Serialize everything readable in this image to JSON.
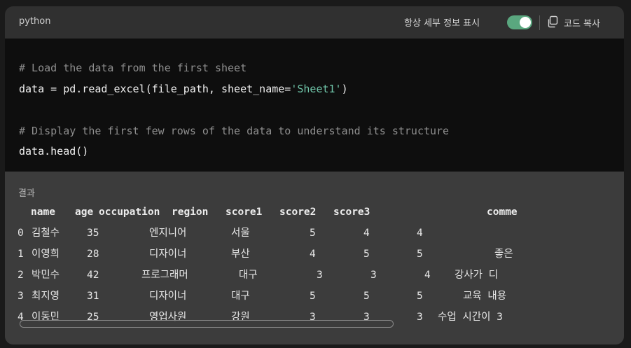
{
  "header": {
    "language": "python",
    "toggle_label": "항상 세부 정보 표시",
    "toggle_on": true,
    "copy_label": "코드 복사",
    "accent_color": "#5aa77f"
  },
  "code": {
    "comment1": "# Load the data from the first sheet",
    "line2_prefix": "data = pd.read_excel(file_path, sheet_name=",
    "line2_string": "'Sheet1'",
    "line2_suffix": ")",
    "comment2": "# Display the first few rows of the data to understand its structure",
    "line5": "data.head()"
  },
  "result": {
    "label": "결과",
    "columns": [
      "name",
      "age",
      "occupation",
      "region",
      "score1",
      "score2",
      "score3",
      "comme"
    ],
    "rows": [
      [
        "0",
        "김철수",
        "35",
        "엔지니어",
        "서울",
        "5",
        "4",
        "4",
        ""
      ],
      [
        "1",
        "이영희",
        "28",
        "디자이너",
        "부산",
        "4",
        "5",
        "5",
        "좋은"
      ],
      [
        "2",
        "박민수",
        "42",
        "프로그래머",
        "대구",
        "3",
        "3",
        "4",
        "강사가 디"
      ],
      [
        "3",
        "최지영",
        "31",
        "디자이너",
        "대구",
        "5",
        "5",
        "5",
        "교육 내용"
      ],
      [
        "4",
        "이동민",
        "25",
        "영업사원",
        "강원",
        "3",
        "3",
        "3",
        "수업 시간이 3"
      ]
    ]
  }
}
